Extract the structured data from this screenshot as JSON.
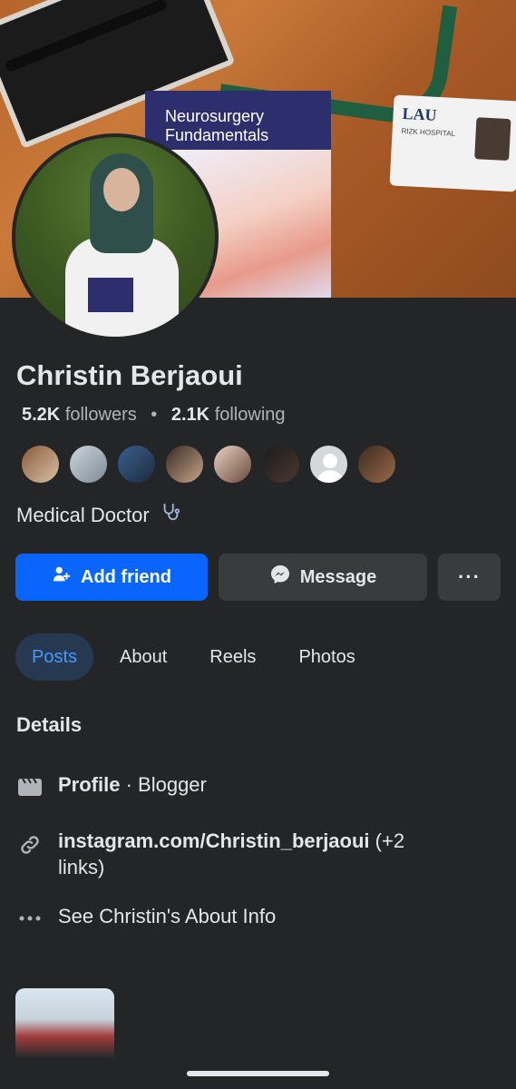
{
  "cover": {
    "book_title": "Neurosurgery Fundamentals",
    "badge_org": "LAU",
    "badge_sub": "RIZK HOSPITAL"
  },
  "profile": {
    "name": "Christin Berjaoui",
    "followers_count": "5.2K",
    "followers_label": "followers",
    "separator": "•",
    "following_count": "2.1K",
    "following_label": "following",
    "bio": "Medical Doctor",
    "bio_icon": "stethoscope-icon"
  },
  "mutual_friends_count": 8,
  "actions": {
    "add_friend": "Add friend",
    "message": "Message",
    "more": "···"
  },
  "tabs": [
    {
      "label": "Posts",
      "active": true
    },
    {
      "label": "About",
      "active": false
    },
    {
      "label": "Reels",
      "active": false
    },
    {
      "label": "Photos",
      "active": false
    }
  ],
  "details": {
    "heading": "Details",
    "profile_label": "Profile",
    "profile_value": "· Blogger",
    "link_bold": "instagram.com/Christin_berjaoui",
    "link_extra": "(+2 links)",
    "about_text": "See Christin's About Info"
  },
  "colors": {
    "background": "#242526",
    "primary_button": "#0866ff",
    "secondary_button": "#3a3b3c",
    "active_tab_bg": "#263951",
    "active_tab_text": "#4599ff"
  }
}
